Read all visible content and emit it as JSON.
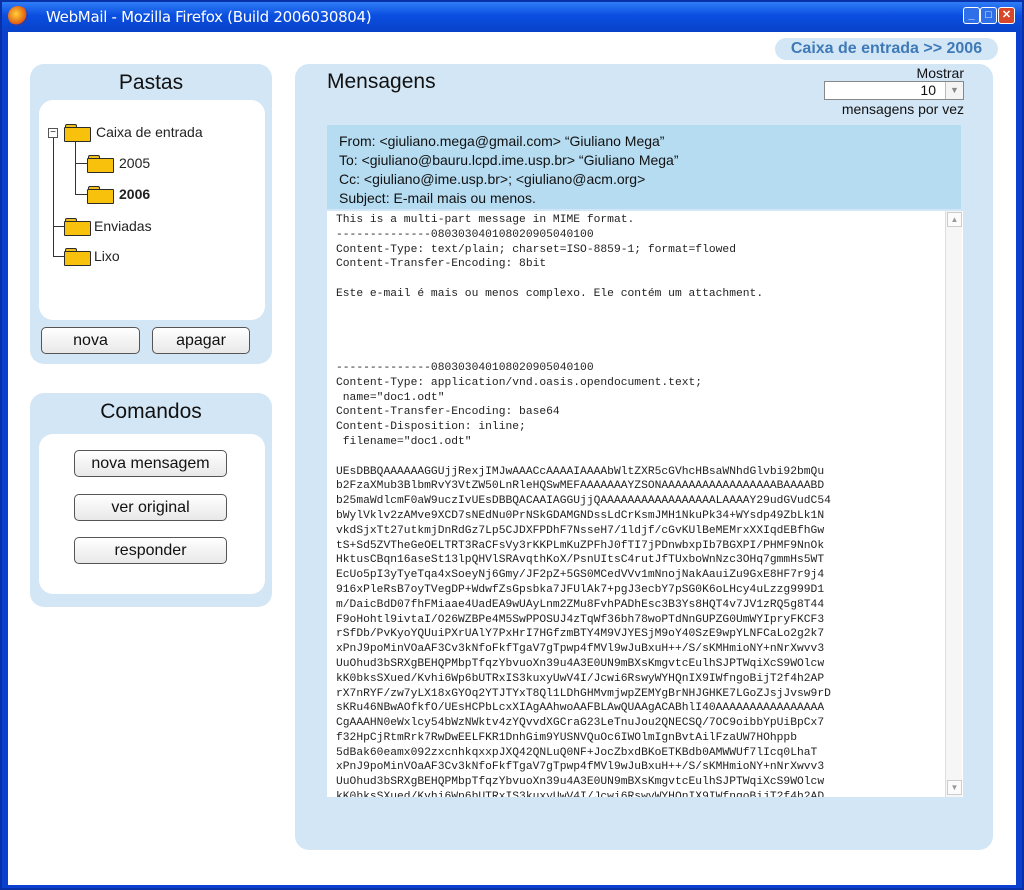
{
  "window": {
    "title": "WebMail - Mozilla Firefox (Build 2006030804)"
  },
  "breadcrumb": "Caixa de entrada >> 2006",
  "folders_panel": {
    "title": "Pastas",
    "items": [
      {
        "label": "Caixa de entrada"
      },
      {
        "label": "2005"
      },
      {
        "label": "2006"
      },
      {
        "label": "Enviadas"
      },
      {
        "label": "Lixo"
      }
    ],
    "buttons": {
      "new": "nova",
      "delete": "apagar"
    }
  },
  "commands_panel": {
    "title": "Comandos",
    "buttons": {
      "new_message": "nova mensagem",
      "view_original": "ver original",
      "reply": "responder"
    }
  },
  "messages_panel": {
    "title": "Mensagens",
    "show_label": "Mostrar",
    "show_value": "10",
    "per_page_label": "mensagens por vez",
    "header": {
      "from": "From: <giuliano.mega@gmail.com> “Giuliano Mega”",
      "to": "To: <giuliano@bauru.lcpd.ime.usp.br> “Giuliano Mega”",
      "cc": "Cc: <giuliano@ime.usp.br>; <giuliano@acm.org>",
      "subject": "Subject: E-mail mais ou menos."
    },
    "body": "This is a multi-part message in MIME format.\n--------------080303040108020905040100\nContent-Type: text/plain; charset=ISO-8859-1; format=flowed\nContent-Transfer-Encoding: 8bit\n\nEste e-mail é mais ou menos complexo. Ele contém um attachment.\n\n\n\n\n--------------080303040108020905040100\nContent-Type: application/vnd.oasis.opendocument.text;\n name=\"doc1.odt\"\nContent-Transfer-Encoding: base64\nContent-Disposition: inline;\n filename=\"doc1.odt\"\n\nUEsDBBQAAAAAAGGUjjRexjIMJwAAACcAAAAIAAAAbWltZXR5cGVhcHBsaWNhdGlvbi92bmQu\nb2FzaXMub3BlbmRvY3VtZW50LnRleHQSwMEFAAAAAAAYZSONAAAAAAAAAAAAAAAAABAAAABD\nb25maWdlcmF0aW9uczIvUEsDBBQACAAIAGGUjjQAAAAAAAAAAAAAAAAALAAAAY29udGVudC54\nbWylVklv2zAMve9XCD7sNEdNu0PrNSkGDAMGNDssLdCrKsmJMH1NkuPk34+WYsdp49ZbLk1N\nvkdSjxTt27utkmjDnRdGz7Lp5CJDXFPDhF7NsseH7/1ldjf/cGvKUlBeMEMrxXXIqdEBfhGw\ntS+Sd5ZVTheGeOELTRT3RaCFsVy3rKKPLmKuZPFhJ0fTI7jPDnwbxpIb7BGXPI/PHMF9NnOk\nHktusCBqn16aseSt13lpQHVlSRAvqthKoX/PsnUItsC4rutJfTUxboWnNzc3OHq7gmmHs5WT\nEcUo5pI3yTyeTqa4xSoeyNj6Gmy/JF2pZ+5GS0MCedVVv1mNnojNakAauiZu9GxE8HF7r9j4\n916xPleRsB7oyTVegDP+WdwfZsGpsbka7JFUlAk7+pgJ3ecbY7pSG0K6oLHcy4uLzzg999D1\nm/DaicBdD07fhFMiaae4UadEA9wUAyLnm2ZMu8FvhPADhEsc3B3Ys8HQT4v7JV1zRQ5g8T44\nF9oHohtl9ivtaI/O26WZBPe4M5SwPPOSUJ4zTqWf36bh78woPTdNnGUPZG0UmWYIpryFKCF3\nrSfDb/PvKyoYQUuiPXrUAlY7PxHrI7HGfzmBTY4M9VJYESjM9oY40SzE9wpYLNFCaLo2g2k7\nxPnJ9poMinVOaAF3Cv3kNfoFkfTgaV7gTpwp4fMVl9wJuBxuH++/S/sKMHmioNY+nNrXwvv3\nUuOhud3bSRXgBEHQPMbpTfqzYbvuoXn39u4A3E0UN9mBXsKmgvtcEulhSJPTWqiXcS9WOlcw\nkK0bksSXued/Kvhi6Wp6bUTRxIS3kuxyUwV4I/Jcwi6RswyWYHQnIX9IWfngoBijT2f4h2AP\nrX7nRYF/zw7yLX18xGYOq2YTJTYxT8Ql1LDhGHMvmjwpZEMYgBrNHJGHKE7LGoZJsjJvsw9rD\nsKRu46NBwAOfkfO/UEsHCPbLcxXIAgAAhwoAAFBLAwQUAAgACABhlI40AAAAAAAAAAAAAAAA\nCgAAAHN0eWxlcy54bWzNWktv4zYQvvdXGCraG23LeTnuJou2QNECSQ/7OC9oibbYpUiBpCx7\nf32HpCjRtmRrk7RwDwEELFKR1DnhGim9YUSNVQuOc6IWOlmIgnBvtAilFzaUW7HOhppb\n5dBak60eamx092zxcnhkqxxpJXQ42QNLuQ0NF+JocZbxdBKoETKBdb0AMWWUf7lIcq0LhaT\nxPnJ9poMinVOaAF3Cv3kNfoFkfTgaV7gTpwp4fMVl9wJuBxuH++/S/sKMHmioNY+nNrXwvv3\nUuOhud3bSRXgBEHQPMbpTfqzYbvuoXn39u4A3E0UN9mBXsKmgvtcEulhSJPTWqiXcS9WOlcw\nkK0bksSXued/Kvhi6Wp6bUTRxIS3kuxyUwV4I/Jcwi6RswyWYHQnIX9IWfngoBijT2f4h2AD"
  }
}
